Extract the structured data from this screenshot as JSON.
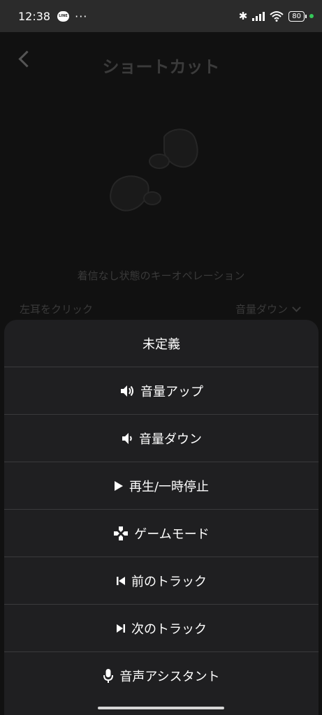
{
  "status_bar": {
    "time": "12:38",
    "dots": "···",
    "battery": "80"
  },
  "page": {
    "title": "ショートカット",
    "subtitle": "着信なし状態のキーオペレーション",
    "setting_label": "左耳をクリック",
    "setting_value": "音量ダウン"
  },
  "sheet": {
    "options": [
      {
        "label": "未定義",
        "icon": "none"
      },
      {
        "label": "音量アップ",
        "icon": "volume-up-icon"
      },
      {
        "label": "音量ダウン",
        "icon": "volume-down-icon"
      },
      {
        "label": "再生/一時停止",
        "icon": "play-icon"
      },
      {
        "label": "ゲームモード",
        "icon": "gamepad-icon"
      },
      {
        "label": "前のトラック",
        "icon": "previous-track-icon"
      },
      {
        "label": "次のトラック",
        "icon": "next-track-icon"
      },
      {
        "label": "音声アシスタント",
        "icon": "microphone-icon"
      }
    ]
  },
  "colors": {
    "status_bar_bg": "#2b2b2b",
    "sheet_bg": "#1f1f21",
    "divider": "#3a3a3c",
    "dim_text": "#3a3a3a",
    "battery_dot": "#35c759"
  }
}
